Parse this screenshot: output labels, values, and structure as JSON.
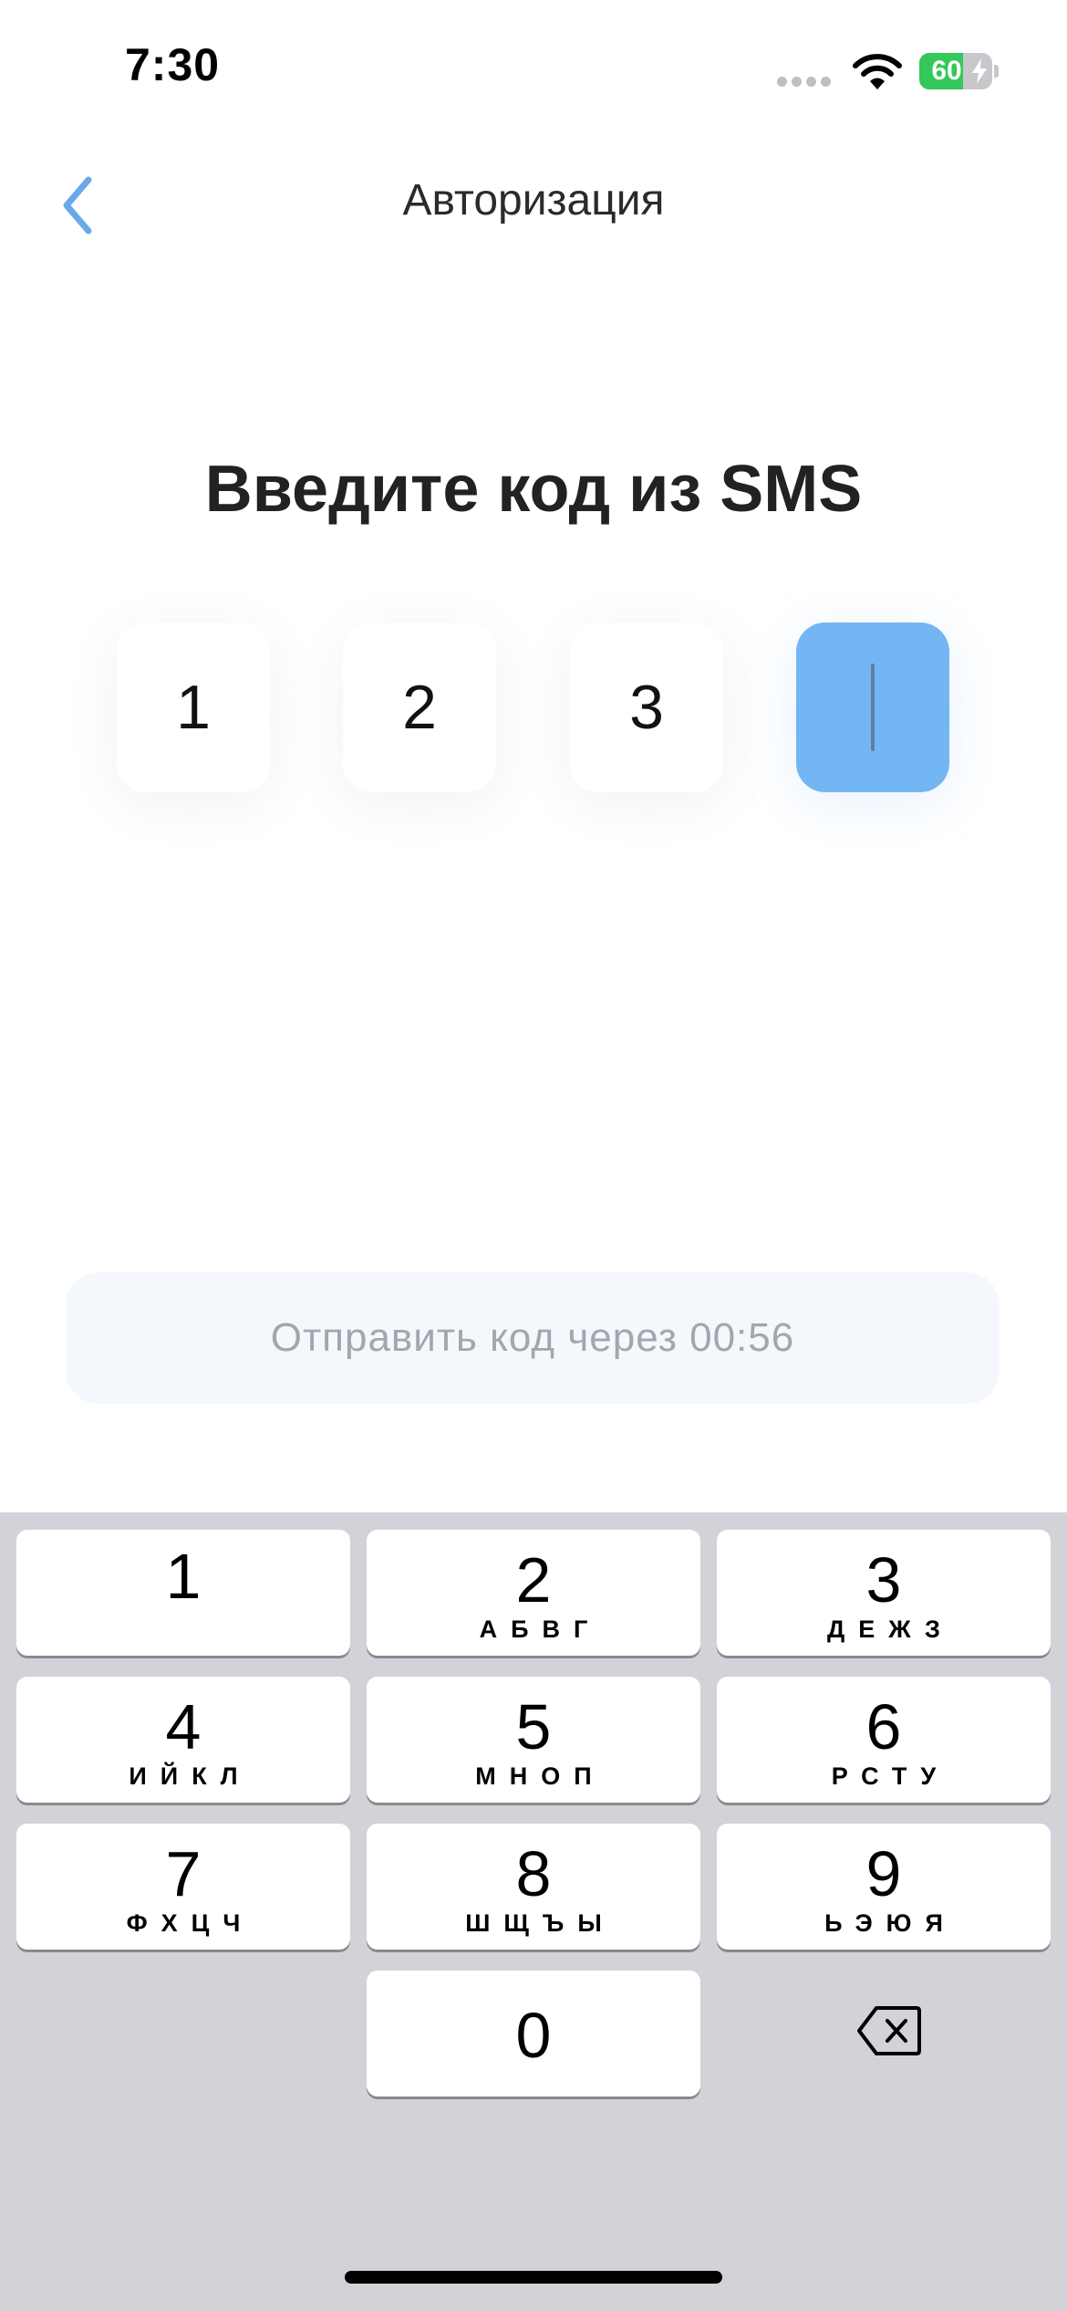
{
  "status_bar": {
    "time": "7:30",
    "battery_level": "60",
    "battery_fraction": 0.6,
    "icons": [
      "signal-dots-icon",
      "wifi-icon",
      "battery-icon",
      "charging-bolt-icon"
    ]
  },
  "nav": {
    "back_icon": "chevron-left-icon",
    "title": "Авторизация"
  },
  "heading": "Введите код из SMS",
  "code_cells": [
    "1",
    "2",
    "3",
    ""
  ],
  "resend_button": "Отправить код через 00:56",
  "keyboard": {
    "keys": [
      {
        "digit": "1",
        "letters": ""
      },
      {
        "digit": "2",
        "letters": "АБВГ"
      },
      {
        "digit": "3",
        "letters": "ДЕЖЗ"
      },
      {
        "digit": "4",
        "letters": "ИЙКЛ"
      },
      {
        "digit": "5",
        "letters": "МНОП"
      },
      {
        "digit": "6",
        "letters": "РСТУ"
      },
      {
        "digit": "7",
        "letters": "ФХЦЧ"
      },
      {
        "digit": "8",
        "letters": "ШЩЪЫ"
      },
      {
        "digit": "9",
        "letters": "ЬЭЮЯ"
      },
      {
        "digit": "0",
        "letters": ""
      }
    ],
    "delete_icon": "backspace-icon"
  },
  "colors": {
    "accent": "#74b6f3",
    "back_icon": "#6aa8ea",
    "resend_bg": "#f4f8fd",
    "resend_text": "#a3a7ad",
    "keyboard_bg": "#d1d3d9",
    "battery_green": "#34c759"
  }
}
